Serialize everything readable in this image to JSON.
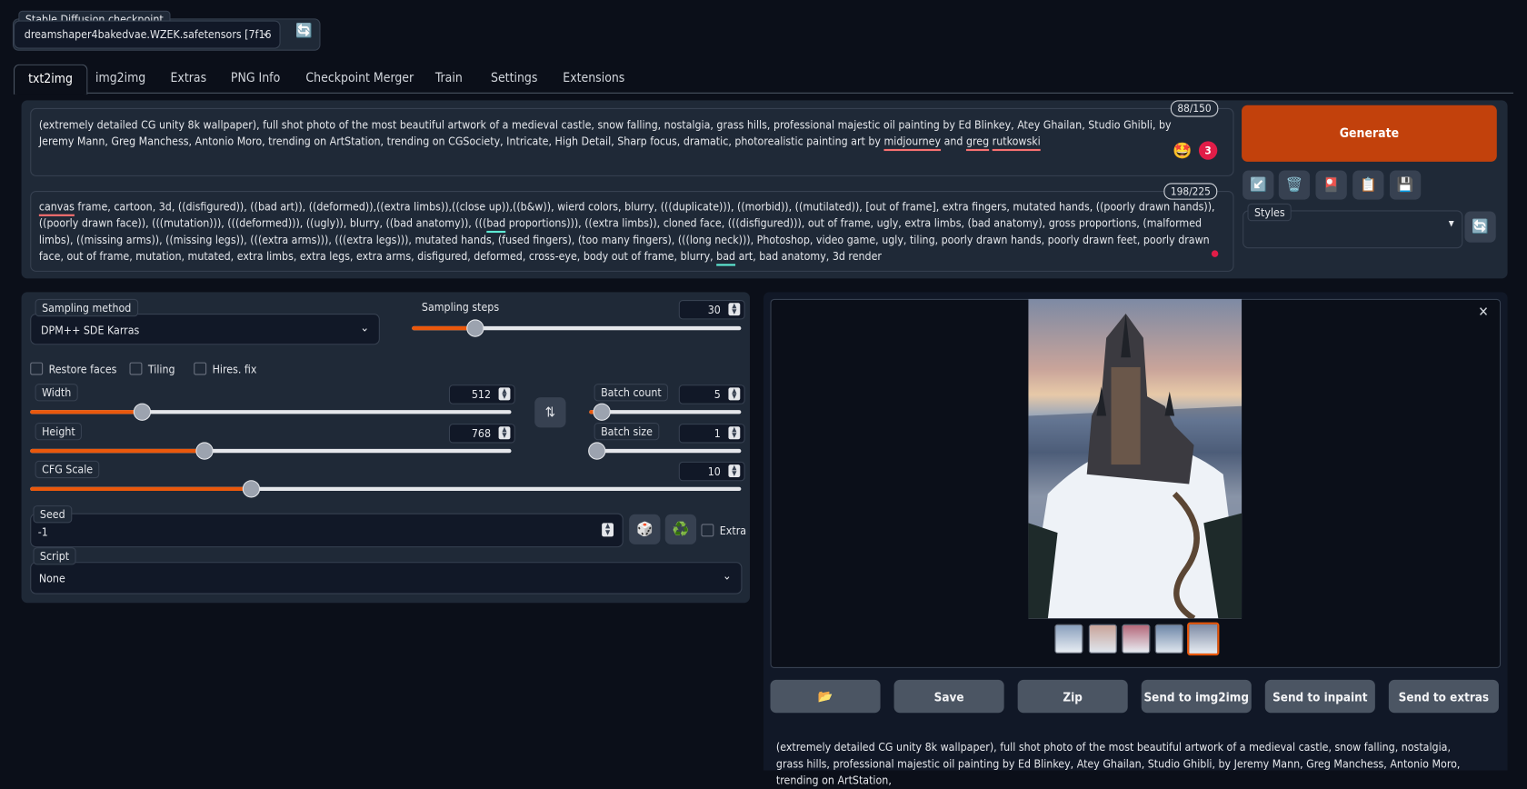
{
  "checkpoint": {
    "label": "Stable Diffusion checkpoint",
    "value": "dreamshaper4bakedvae.WZEK.safetensors [7f16",
    "refresh_icon": "refresh-icon"
  },
  "tabs": [
    "txt2img",
    "img2img",
    "Extras",
    "PNG Info",
    "Checkpoint Merger",
    "Train",
    "Settings",
    "Extensions"
  ],
  "active_tab": "txt2img",
  "prompt": {
    "counter": "88/150",
    "parts": [
      "(extremely detailed CG unity 8k wallpaper), full shot photo of the most beautiful artwork of a medieval castle, snow falling, nostalgia, grass hills, professional majestic oil painting by Ed Blinkey, Atey Ghailan, Studio Ghibli, by Jeremy Mann, Greg Manchess, Antonio Moro, trending on ArtStation, trending on CGSociety, Intricate, High Detail, Sharp focus, dramatic, photorealistic painting art by ",
      "midjourney",
      " and ",
      "greg",
      " ",
      "rutkowski"
    ],
    "badge": "3"
  },
  "negative_prompt": {
    "counter": "198/225",
    "parts": [
      "canvas",
      " frame, cartoon, 3d, ((disfigured)), ((bad art)), ((deformed)),((extra limbs)),((close up)),((b&w)), wierd colors, blurry, (((duplicate))), ((morbid)), ((mutilated)), [out of frame], extra fingers, mutated hands, ((poorly drawn hands)), ((poorly drawn face)), (((mutation))), (((deformed))), ((ugly)), blurry, ((bad anatomy)), (((",
      "bad",
      " proportions))), ((extra limbs)), cloned face, (((disfigured))), out of frame, ugly, extra limbs, (bad anatomy), gross proportions, (malformed limbs), ((missing arms)), ((missing legs)), (((extra arms))), (((extra legs))), mutated hands, (fused fingers), (too many fingers), (((long neck))), Photoshop, video game, ugly, tiling, poorly drawn hands, poorly drawn feet, poorly drawn face, out of frame, mutation, mutated, extra limbs, extra legs, extra arms, disfigured, deformed, cross-eye, body out of frame, blurry, ",
      "bad",
      " art, bad anatomy, 3d render"
    ]
  },
  "generate": {
    "label": "Generate",
    "color": "#c2410c"
  },
  "tool_icons": [
    "arrow-icon",
    "trash-icon",
    "card-icon",
    "clipboard-icon",
    "floppy-disk-icon"
  ],
  "styles": {
    "label": "Styles",
    "value": ""
  },
  "settings": {
    "sampling_method": {
      "label": "Sampling method",
      "value": "DPM++ SDE Karras"
    },
    "sampling_steps": {
      "label": "Sampling steps",
      "value": "30",
      "fraction": 0.19
    },
    "restore_faces": {
      "label": "Restore faces",
      "checked": false
    },
    "tiling": {
      "label": "Tiling",
      "checked": false
    },
    "hires_fix": {
      "label": "Hires. fix",
      "checked": false
    },
    "width": {
      "label": "Width",
      "value": "512",
      "fraction": 0.23
    },
    "height": {
      "label": "Height",
      "value": "768",
      "fraction": 0.36
    },
    "batch_count": {
      "label": "Batch count",
      "value": "5",
      "fraction": 0.08
    },
    "batch_size": {
      "label": "Batch size",
      "value": "1",
      "fraction": 0.0
    },
    "cfg_scale": {
      "label": "CFG Scale",
      "value": "10",
      "fraction": 0.31
    },
    "seed": {
      "label": "Seed",
      "value": "-1"
    },
    "extra": {
      "label": "Extra",
      "checked": false
    },
    "script": {
      "label": "Script",
      "value": "None"
    }
  },
  "gallery": {
    "buttons": [
      "",
      "Save",
      "Zip",
      "Send to img2img",
      "Send to inpaint",
      "Send to extras"
    ],
    "folder_icon": "folder-icon",
    "selected_thumb": 5,
    "info": "(extremely detailed CG unity 8k wallpaper), full shot photo of the most beautiful artwork of a medieval castle, snow falling, nostalgia, grass hills, professional majestic oil painting by Ed Blinkey, Atey Ghailan, Studio Ghibli, by Jeremy Mann, Greg Manchess, Antonio Moro, trending on ArtStation,"
  }
}
